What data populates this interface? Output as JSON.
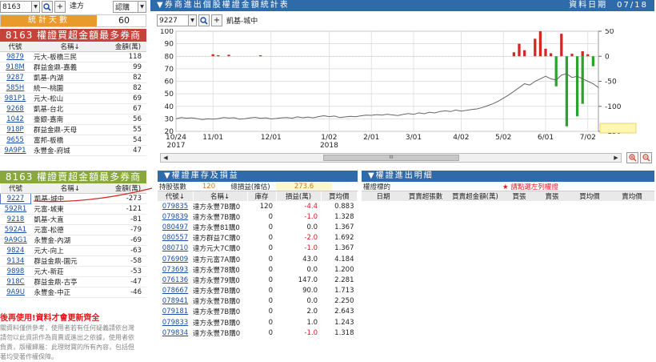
{
  "controls": {
    "stock_code": "8163",
    "stock_name": "達方",
    "type_select": "認購"
  },
  "days": {
    "label": "統計天數",
    "value": "60"
  },
  "buy_rank": {
    "title": "8163 權證買超金額最多券商",
    "headers": [
      "代號",
      "名稱↓",
      "金額(萬)"
    ],
    "rows": [
      [
        "9879",
        "元大-板橋三民",
        "118"
      ],
      [
        "918M",
        "群益金鼎-嘉義",
        "99"
      ],
      [
        "9287",
        "凱基-內湖",
        "82"
      ],
      [
        "585H",
        "統一-桃園",
        "82"
      ],
      [
        "981P1",
        "元大-松山",
        "69"
      ],
      [
        "9268",
        "凱基-台北",
        "67"
      ],
      [
        "1042",
        "臺銀-嘉南",
        "56"
      ],
      [
        "918P",
        "群益金鼎-天母",
        "55"
      ],
      [
        "9655",
        "富邦-板橋",
        "54"
      ],
      [
        "9A9P1",
        "永豐金-府城",
        "47"
      ]
    ]
  },
  "sell_rank": {
    "title": "8163 權證賣超金額最多券商",
    "headers": [
      "代號",
      "名稱↓",
      "金額(萬)"
    ],
    "rows": [
      [
        "9227",
        "凱基-城中",
        "-273"
      ],
      [
        "592R1",
        "元富-城東",
        "-121"
      ],
      [
        "9218",
        "凱基-大直",
        "-81"
      ],
      [
        "592A1",
        "元富-松德",
        "-79"
      ],
      [
        "9A9G1",
        "永豐金-內湖",
        "-69"
      ],
      [
        "9824",
        "元大-向上",
        "-63"
      ],
      [
        "9134",
        "群益金鼎-園元",
        "-58"
      ],
      [
        "9898",
        "元大-新莊",
        "-53"
      ],
      [
        "918C",
        "群益金鼎-古亭",
        "-47"
      ],
      [
        "9A9U",
        "永豐金-中正",
        "-46"
      ]
    ]
  },
  "notice_red": "後再使用!資料才會更新齊全",
  "notice_gray": [
    "關資料僅供參考，使用者若有任何疑義請依台灣",
    "請勿以此資訊作為買賣或進出之依據，使用者依",
    "負責，版權歸屬：此理財寶的所有內容，包括但",
    "著均受著作權保障。"
  ],
  "chart_panel": {
    "title": "▼券商進出個股權證金額統計表",
    "date_label": "資料日期",
    "date_value": "07/18",
    "broker_code": "9227",
    "broker_name": "凱基-城中"
  },
  "chart_data": {
    "type": "line",
    "title": "",
    "x_ticks": [
      "10/24",
      "11/01",
      "12/01",
      "1/02",
      "2/01",
      "3/01",
      "4/02",
      "5/02",
      "6/01",
      "7/02"
    ],
    "x_year_labels": {
      "10/24": "2017",
      "1/02": "2018"
    },
    "ylim_left": [
      20,
      100
    ],
    "yticks_left": [
      100,
      90,
      80,
      70,
      60,
      50,
      40,
      30,
      20
    ],
    "ylim_right": [
      -150,
      50
    ],
    "yticks_right": [
      50,
      0,
      -50,
      -100,
      -150
    ],
    "grid": true,
    "series": [
      {
        "kind": "price_line",
        "axis": "left",
        "color": "#666666",
        "values": [
          30,
          31,
          30.5,
          30.8,
          30.2,
          29.5,
          30,
          29.8,
          30.2,
          31,
          30.6,
          30.9,
          29.8,
          30.1,
          30.7,
          31.2,
          30.4,
          30.8,
          29.9,
          30.3,
          30.8,
          31,
          30.5,
          31.6,
          30.9,
          31.4,
          30.8,
          31.8,
          32.5,
          31.8,
          32.2,
          31,
          31.5,
          32,
          31.7,
          32.4,
          33,
          32.8,
          33.4,
          32.9,
          33.7,
          33.1,
          32.6,
          33.5,
          34.2,
          33.6,
          34.8,
          34.1,
          35.3,
          34.7,
          35.9,
          36.4,
          35.8,
          37,
          36.2,
          36.8,
          37.5,
          37.9,
          39,
          40.5,
          42,
          44,
          46.5,
          49,
          52,
          55,
          58,
          57,
          60,
          62,
          64,
          62,
          61,
          65,
          66,
          63,
          64,
          62,
          60,
          58,
          55
        ]
      },
      {
        "kind": "net_bars",
        "axis": "right",
        "up_color": "#d42626",
        "down_color": "#2aa32a",
        "values": [
          0,
          0,
          0,
          0,
          0,
          0,
          0,
          0,
          0,
          0,
          0,
          0,
          0,
          0,
          0,
          0,
          0,
          0,
          0,
          0,
          0,
          0,
          0,
          0,
          0,
          0,
          0,
          0,
          0,
          0,
          0,
          0,
          0,
          0,
          0,
          0,
          0,
          0,
          0,
          0,
          0,
          0,
          0,
          0,
          0,
          0,
          0,
          0,
          0,
          0,
          0,
          0,
          0,
          0,
          0,
          0,
          0,
          0,
          0,
          0,
          0,
          0,
          0,
          0,
          0,
          0,
          0,
          0,
          0,
          0,
          0,
          0,
          0,
          0,
          0,
          0,
          0,
          0,
          0,
          0,
          0
        ]
      }
    ],
    "bar_events": [
      {
        "x_index": 7,
        "value": 4,
        "color": "up"
      },
      {
        "x_index": 8,
        "value": 2,
        "color": "up"
      },
      {
        "x_index": 10,
        "value": 3,
        "color": "up"
      },
      {
        "x_index": 16,
        "value": 2,
        "color": "up"
      },
      {
        "x_index": 64,
        "value": 8,
        "color": "up"
      },
      {
        "x_index": 65,
        "value": 25,
        "color": "up"
      },
      {
        "x_index": 66,
        "value": 12,
        "color": "up"
      },
      {
        "x_index": 68,
        "value": 35,
        "color": "up"
      },
      {
        "x_index": 69,
        "value": 50,
        "color": "up"
      },
      {
        "x_index": 70,
        "value": 15,
        "color": "up"
      },
      {
        "x_index": 71,
        "value": 6,
        "color": "up"
      },
      {
        "x_index": 73,
        "value": 45,
        "color": "up"
      },
      {
        "x_index": 75,
        "value": 5,
        "color": "up"
      },
      {
        "x_index": 77,
        "value": 10,
        "color": "up"
      },
      {
        "x_index": 78,
        "value": 4,
        "color": "up"
      },
      {
        "x_index": 72,
        "value": -60,
        "color": "down"
      },
      {
        "x_index": 74,
        "value": -140,
        "color": "down"
      },
      {
        "x_index": 76,
        "value": -120,
        "color": "down"
      },
      {
        "x_index": 77,
        "value": -95,
        "color": "down"
      },
      {
        "x_index": 79,
        "value": -20,
        "color": "down"
      }
    ]
  },
  "inventory": {
    "title": "▼權證庫存及損益",
    "holding_label": "持股張數",
    "holding_value": "120",
    "pnl_label": "總損益(推估)",
    "pnl_value": "273.6",
    "headers": [
      "代號↓",
      "名稱↓",
      "庫存",
      "損益(萬)",
      "買均價"
    ],
    "rows": [
      [
        "079835",
        "達方永豐7B購0",
        "120",
        "-4.4",
        "0.883"
      ],
      [
        "079839",
        "達方永豐7B購0",
        "0",
        "-1.0",
        "1.328"
      ],
      [
        "080497",
        "達方永豐81購0",
        "0",
        "0.0",
        "1.367"
      ],
      [
        "080557",
        "達方群益7C購0",
        "0",
        "-2.0",
        "1.692"
      ],
      [
        "080710",
        "達方元大7C購0",
        "0",
        "-1.0",
        "1.367"
      ],
      [
        "076909",
        "達方元富7A購0",
        "0",
        "43.0",
        "4.184"
      ],
      [
        "073693",
        "達方永豐78購0",
        "0",
        "0.0",
        "1.200"
      ],
      [
        "076136",
        "達方永豐79購0",
        "0",
        "147.0",
        "2.281"
      ],
      [
        "078667",
        "達方永豐7B購0",
        "0",
        "90.0",
        "1.713"
      ],
      [
        "078941",
        "達方永豐7B購0",
        "0",
        "0.0",
        "2.250"
      ],
      [
        "079181",
        "達方永豐7B購0",
        "0",
        "2.0",
        "2.643"
      ],
      [
        "079833",
        "達方永豐7B購0",
        "0",
        "1.0",
        "1.243"
      ],
      [
        "079834",
        "達方永豐7B購0",
        "0",
        "-1.0",
        "1.318"
      ]
    ]
  },
  "detail": {
    "title": "▼權證進出明細",
    "target_label": "權證標的",
    "hint": "★ 請點選左列權證",
    "headers": [
      "日期",
      "買賣超張數",
      "買賣超金額(萬)",
      "買張",
      "賣張",
      "買均價",
      "賣均價"
    ]
  }
}
